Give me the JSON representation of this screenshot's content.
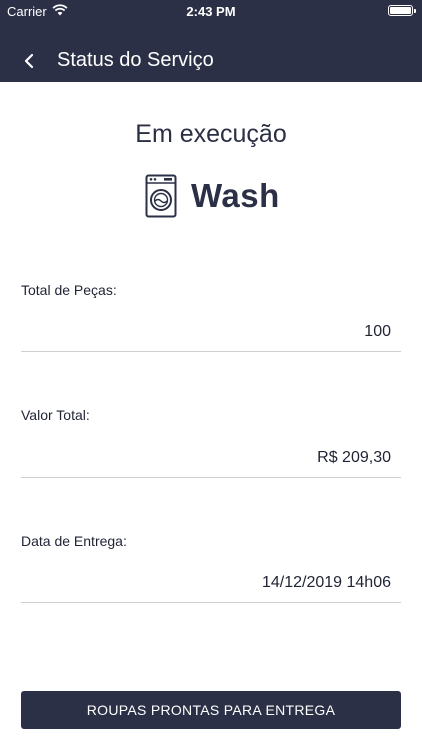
{
  "status_bar": {
    "carrier": "Carrier",
    "time": "2:43 PM"
  },
  "nav": {
    "title": "Status do Serviço"
  },
  "service": {
    "state": "Em execução",
    "brand": "Wash"
  },
  "fields": [
    {
      "label": "Total de Peças:",
      "value": "100"
    },
    {
      "label": "Valor Total:",
      "value": "R$ 209,30"
    },
    {
      "label": "Data de Entrega:",
      "value": "14/12/2019 14h06"
    }
  ],
  "action": {
    "label": "ROUPAS PRONTAS PARA ENTREGA"
  },
  "colors": {
    "header": "#2b3046",
    "button": "#2b3046",
    "text": "#1f2333",
    "divider": "#cfcfd4"
  }
}
